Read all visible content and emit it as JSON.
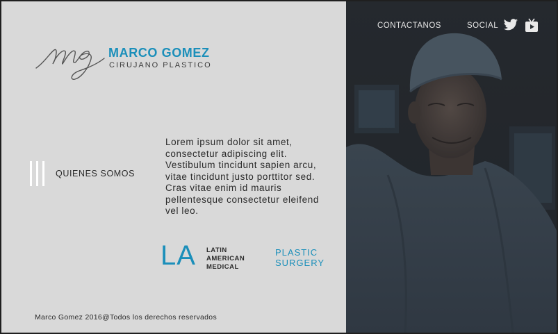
{
  "brand": {
    "name": "MARCO GOMEZ",
    "subtitle": "CIRUJANO PLASTICO",
    "monogram": "mg"
  },
  "nav": {
    "contact_label": "CONTACTANOS",
    "social_label": "SOCIAL",
    "icons": [
      "twitter-icon",
      "youtube-icon"
    ]
  },
  "menu": {
    "label": "QUIENES SOMOS",
    "icon": "menu-bars-icon"
  },
  "intro_text": "Lorem ipsum dolor sit amet, consectetur adipiscing elit. Vestibulum tincidunt sapien arcu, vitae tincidunt justo porttitor sed. Cras vitae enim id mauris pellentesque consectetur eleifend vel leo.",
  "partner": {
    "short": "LA",
    "line1": "LATIN",
    "line2": "AMERICAN",
    "line3": "MEDICAL"
  },
  "specialty": {
    "line1": "PLASTIC",
    "line2": "SURGERY"
  },
  "footer": "Marco Gomez 2016@Todos los derechos reservados",
  "colors": {
    "accent": "#1b8fba",
    "panel": "#d9d9d9",
    "text": "#2b2b2b"
  }
}
